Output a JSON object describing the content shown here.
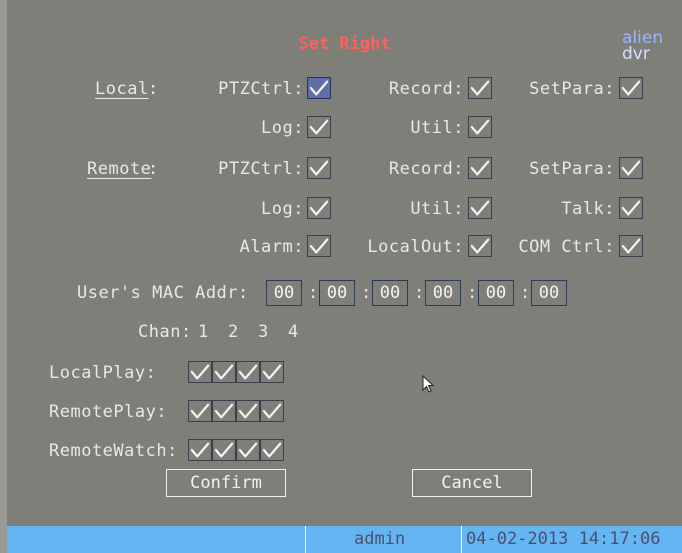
{
  "title": "Set Right",
  "logo": {
    "line1": "alien",
    "line2": "dvr"
  },
  "local": {
    "label": "Local",
    "colon": ":",
    "ptzctrl": "PTZCtrl:",
    "record": "Record:",
    "setpara": "SetPara:",
    "log": "Log:",
    "util": "Util:"
  },
  "remote": {
    "label": "Remote",
    "colon": ":",
    "ptzctrl": "PTZCtrl:",
    "record": "Record:",
    "setpara": "SetPara:",
    "log": "Log:",
    "util": "Util:",
    "talk": "Talk:",
    "alarm": "Alarm:",
    "localout": "LocalOut:",
    "comctrl": "COM Ctrl:"
  },
  "mac": {
    "label": "User's MAC Addr:",
    "octets": [
      "00",
      "00",
      "00",
      "00",
      "00",
      "00"
    ],
    "sep": ":"
  },
  "chan": {
    "label": "Chan:",
    "numbers": [
      "1",
      "2",
      "3",
      "4"
    ]
  },
  "rows": {
    "localplay": "LocalPlay:",
    "remoteplay": "RemotePlay:",
    "remotewatch": "RemoteWatch:"
  },
  "buttons": {
    "confirm": "Confirm",
    "cancel": "Cancel"
  },
  "status": {
    "user": "admin",
    "datetime": "04-02-2013 14:17:06"
  },
  "colors": {
    "bar": "#64b6f3",
    "title": "#ff6060"
  }
}
